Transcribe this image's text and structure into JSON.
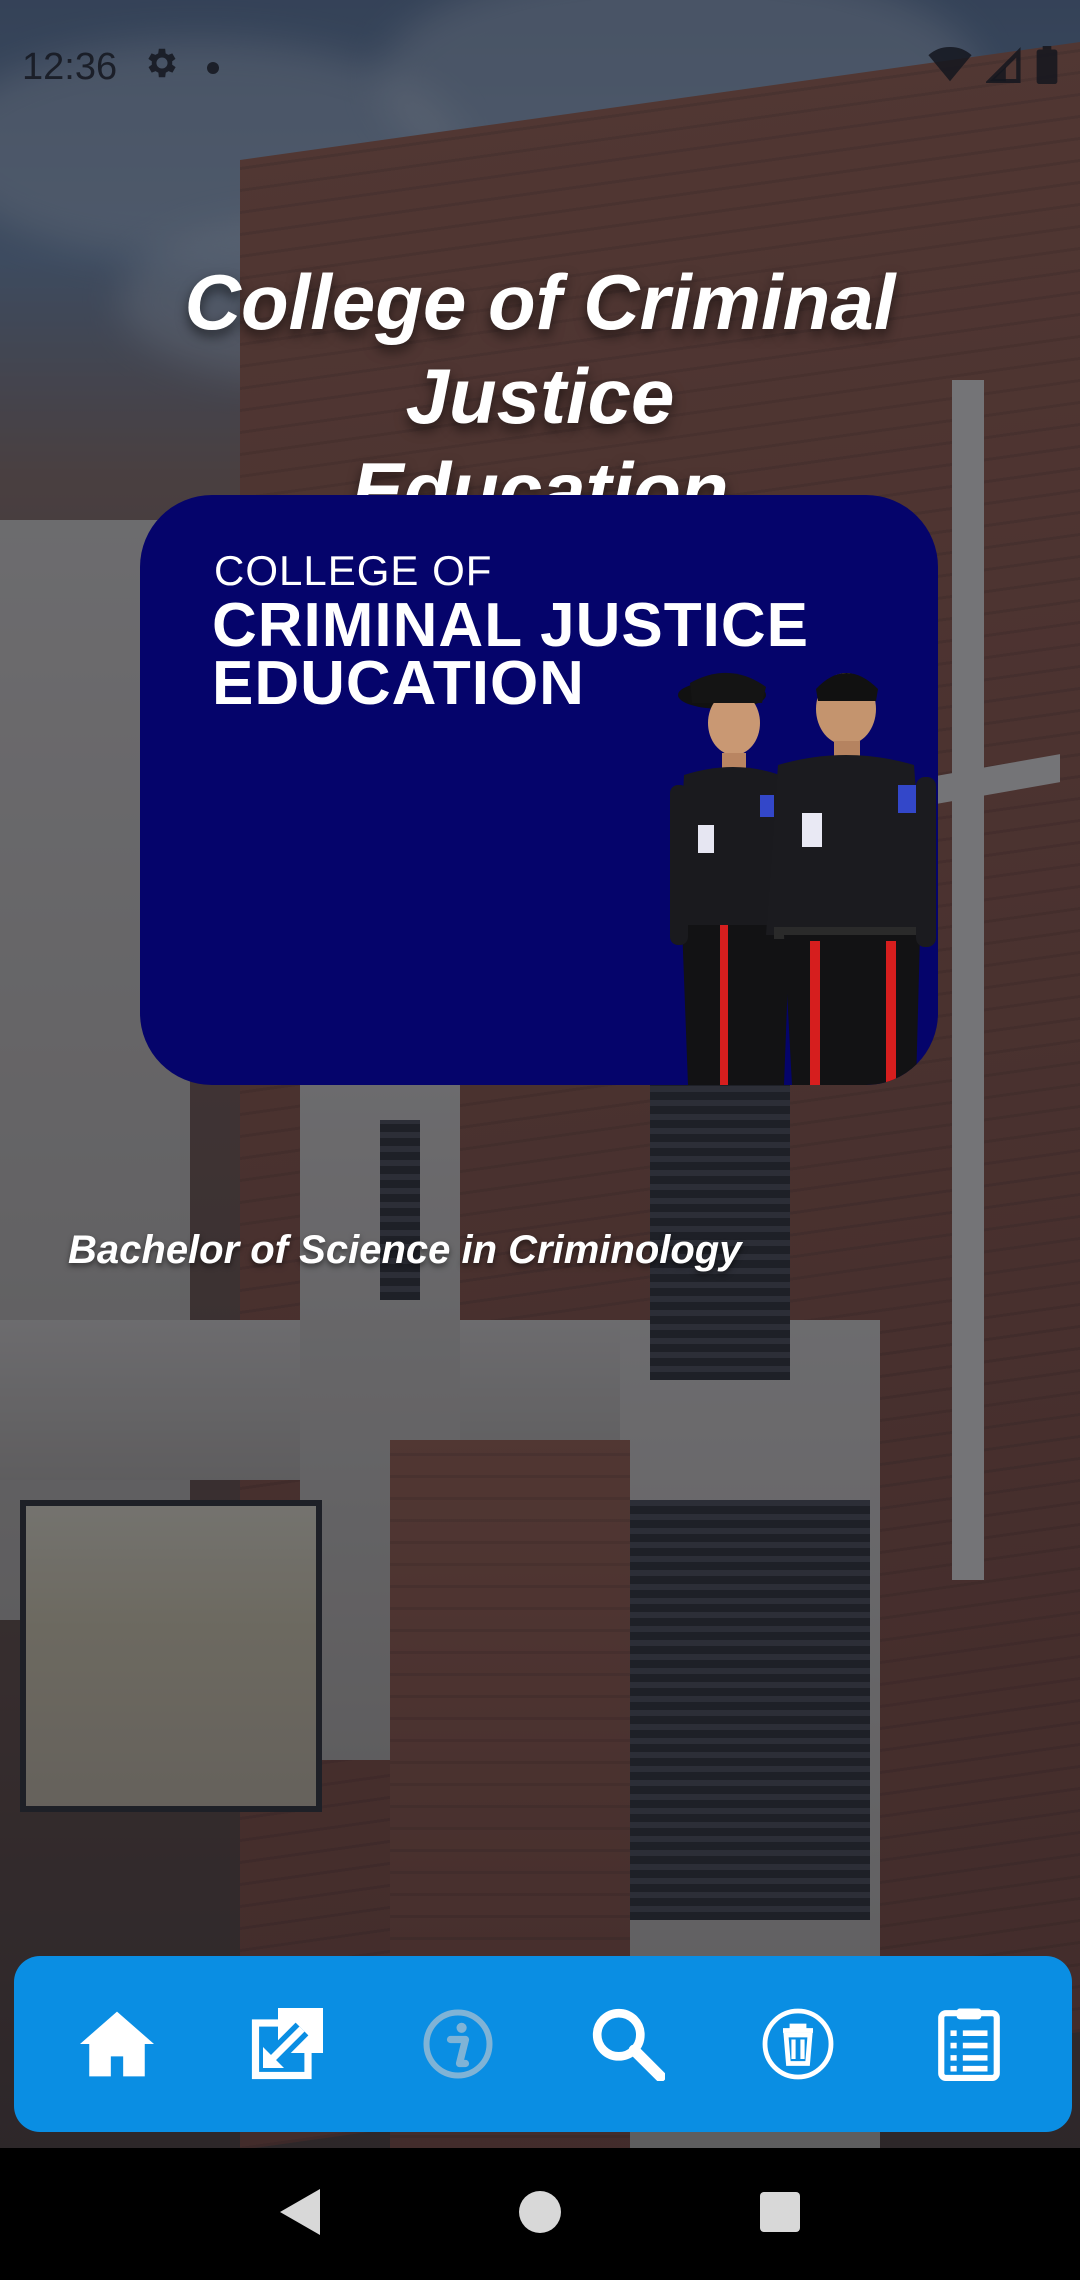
{
  "status_bar": {
    "time": "12:36"
  },
  "header": {
    "title_line1": "College of Criminal Justice",
    "title_line2": "Education"
  },
  "banner": {
    "line1": "COLLEGE OF",
    "line2": "CRIMINAL JUSTICE",
    "line3": "EDUCATION",
    "background_color": "#05046b"
  },
  "program": {
    "name": "Bachelor of Science in Criminology"
  },
  "bottom_nav": {
    "background_color": "#0a8ee3",
    "items": [
      {
        "icon": "home-icon"
      },
      {
        "icon": "external-link-icon"
      },
      {
        "icon": "info-icon"
      },
      {
        "icon": "search-icon"
      },
      {
        "icon": "trash-icon"
      },
      {
        "icon": "checklist-icon"
      }
    ]
  },
  "system_nav": {
    "items": [
      {
        "icon": "back-icon"
      },
      {
        "icon": "home-circle-icon"
      },
      {
        "icon": "recents-icon"
      }
    ]
  }
}
